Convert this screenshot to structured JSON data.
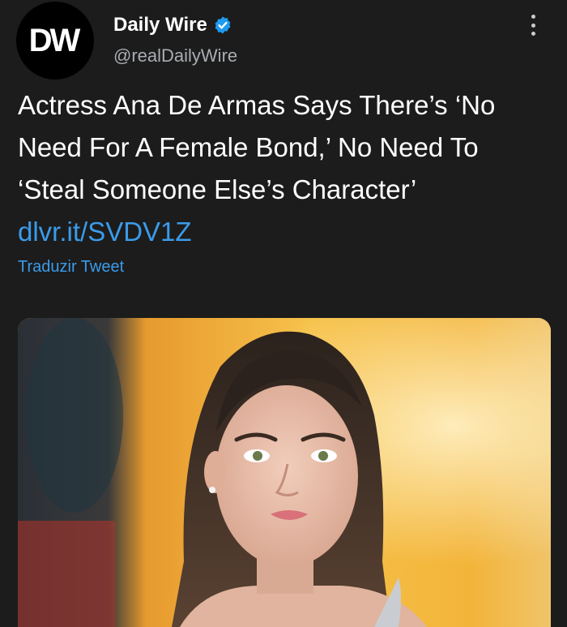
{
  "account": {
    "avatar_text": "DW",
    "display_name": "Daily Wire",
    "verified_icon": "verified-badge-icon",
    "handle": "@realDailyWire"
  },
  "tweet": {
    "text": "Actress Ana De Armas Says There’s ‘No Need For A Female Bond,’ No Need To ‘Steal Someone Else’s Character’",
    "link": "dlvr.it/SVDV1Z",
    "translate_label": "Traduzir Tweet"
  },
  "colors": {
    "background": "#1c1c1c",
    "link": "#3b9bea",
    "verified": "#1d9bf0",
    "secondary_text": "#a8adb3"
  },
  "icons": {
    "more": "more-vertical-icon"
  }
}
